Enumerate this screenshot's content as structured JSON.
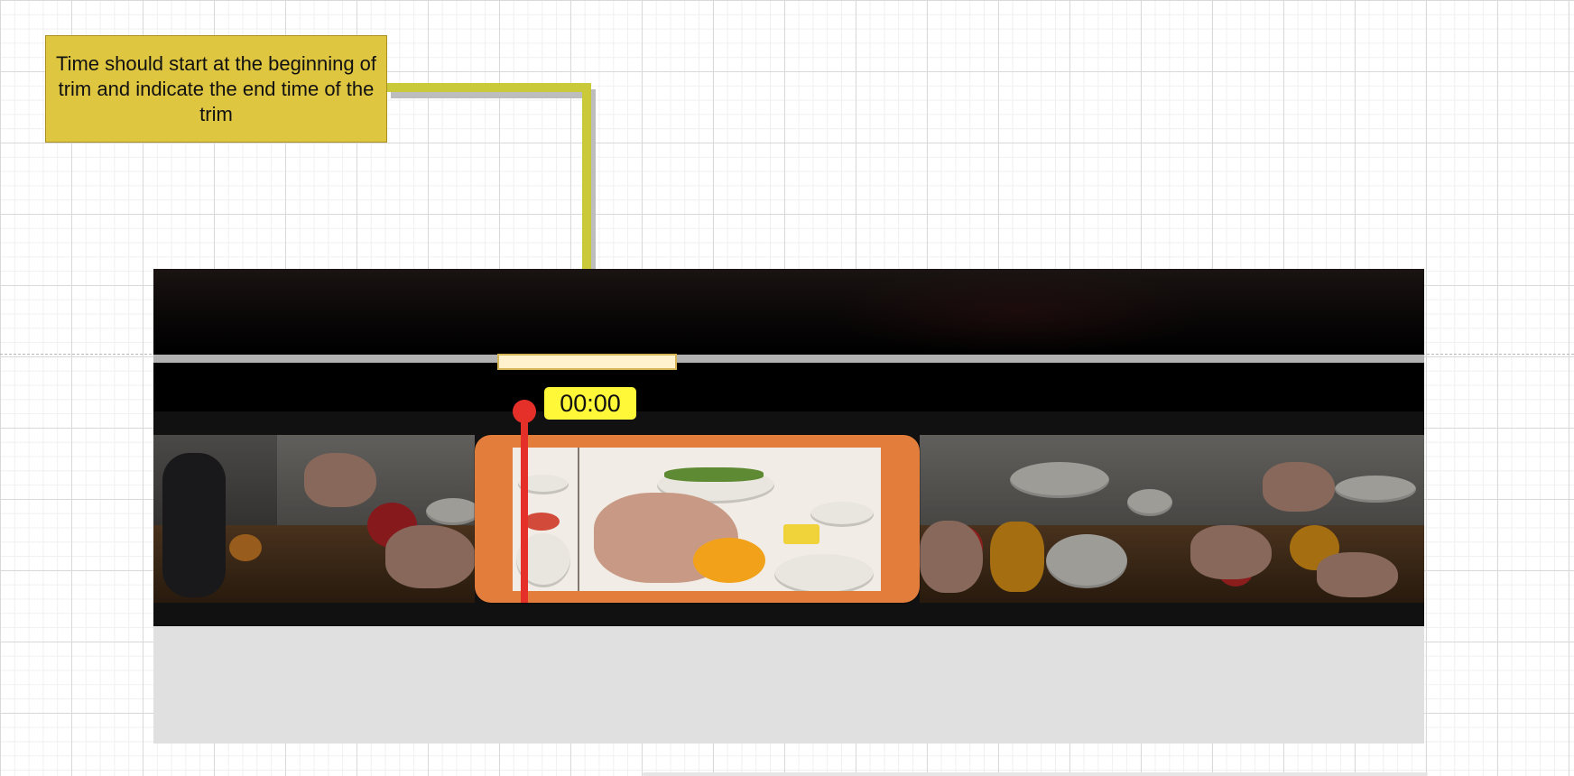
{
  "annotation": {
    "text": "Time should start at the beginning of trim and indicate the end time of the trim",
    "fill_color": "#dfc641",
    "arrow_color": "#c9c93a"
  },
  "player": {
    "time_label": "00:00",
    "playhead_color": "#e5302a",
    "trim_color": "#e27d3c",
    "time_label_color": "#fff838",
    "progress_highlight_color": "#fff2cc"
  },
  "filmstrip": {
    "frames": [
      "frame-1",
      "frame-2",
      "frame-3",
      "frame-4",
      "frame-5",
      "frame-6"
    ]
  }
}
